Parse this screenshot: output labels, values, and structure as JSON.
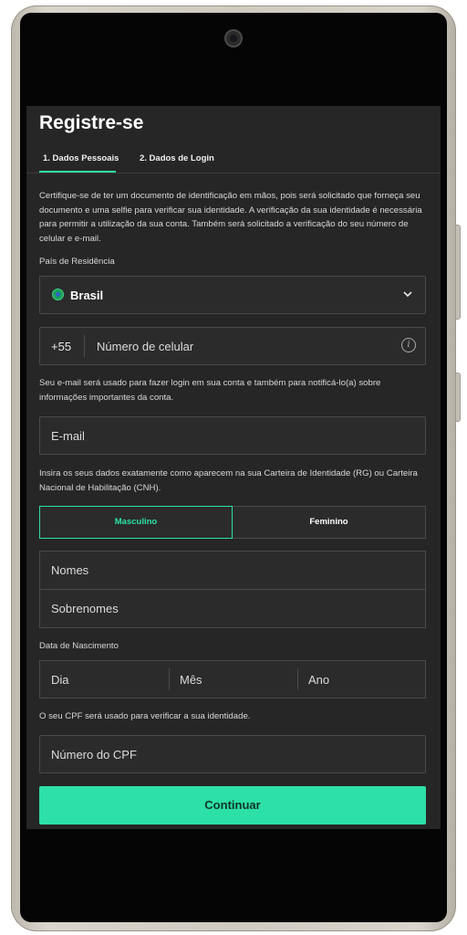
{
  "header": {
    "title": "Registre-se"
  },
  "tabs": [
    {
      "label": "1. Dados Pessoais",
      "active": true
    },
    {
      "label": "2. Dados de Login",
      "active": false
    }
  ],
  "intro_text": "Certifique-se de ter um documento de identificação em mãos, pois será solicitado que forneça seu documento e uma selfie para verificar sua identidade. A verificação da sua identidade é necessária para permitir a utilização da sua conta. Também será solicitado a verificação do seu número de celular e e-mail.",
  "country": {
    "label": "País de Residência",
    "value": "Brasil",
    "flag_icon": "brazil-flag-icon"
  },
  "phone": {
    "prefix": "+55",
    "placeholder": "Número de celular",
    "info_icon": "i"
  },
  "email": {
    "info": "Seu e-mail será usado para fazer login em sua conta e também para notificá-lo(a) sobre informações importantes da conta.",
    "placeholder": "E-mail"
  },
  "identity_info": "Insira os seus dados exatamente como aparecem na sua Carteira de Identidade (RG) ou Carteira Nacional de Habilitação (CNH).",
  "gender": {
    "options": [
      "Masculino",
      "Feminino"
    ],
    "selected": "Masculino"
  },
  "name": {
    "first_placeholder": "Nomes",
    "last_placeholder": "Sobrenomes"
  },
  "dob": {
    "label": "Data de Nascimento",
    "day": "Dia",
    "month": "Mês",
    "year": "Ano"
  },
  "cpf": {
    "info": "O seu CPF será usado para verificar a sua identidade.",
    "placeholder": "Número do CPF"
  },
  "actions": {
    "continue_label": "Continuar"
  },
  "colors": {
    "accent": "#2de0a7",
    "background": "#262626",
    "field": "#2b2b2b",
    "border": "#4a4a4a"
  }
}
